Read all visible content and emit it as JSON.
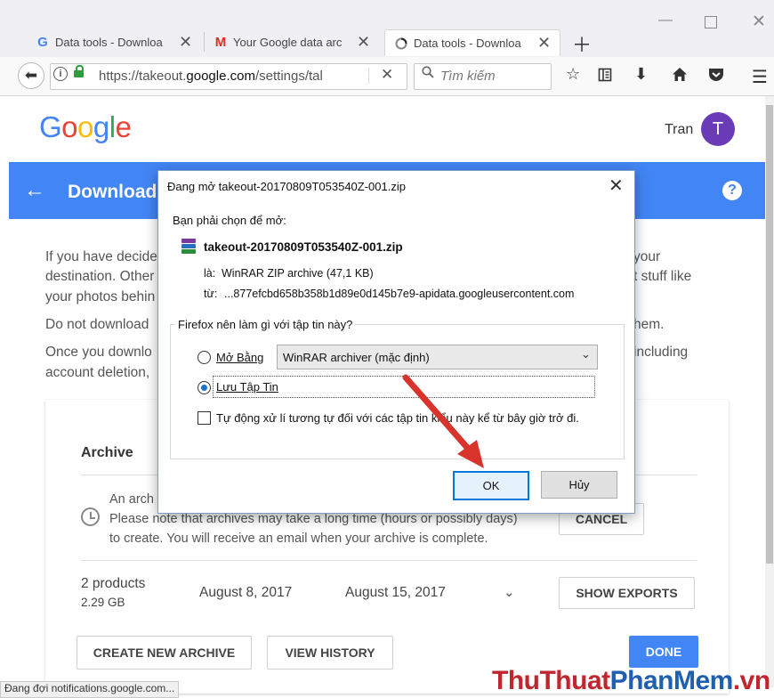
{
  "browser": {
    "tabs": [
      {
        "title": "Data tools - Downloa",
        "favicon": "google-g-icon"
      },
      {
        "title": "Your Google data arc",
        "favicon": "gmail-icon"
      },
      {
        "title": "Data tools - Downloa",
        "favicon": "loading-icon"
      }
    ],
    "url_prefix": "https://takeout.",
    "url_domain": "google.com",
    "url_suffix": "/settings/tal",
    "search_placeholder": "Tìm kiếm",
    "status_text": "Đang đợi notifications.google.com..."
  },
  "page": {
    "logo_letters": [
      "G",
      "o",
      "o",
      "g",
      "l",
      "e"
    ],
    "logo_colors": [
      "#4285F4",
      "#EA4335",
      "#FBBC05",
      "#4285F4",
      "#34A853",
      "#EA4335"
    ],
    "user_name": "Tran",
    "avatar_letter": "T",
    "title": "Download",
    "para1_line1_left": "If you have decide",
    "para1_line1_right": "your",
    "para1_line2_left": "destination. Other",
    "para1_line2_right": "t stuff like",
    "para1_line3_left": "your photos behin",
    "para2_left": "Do not download",
    "para2_right": "hem.",
    "para3_line1_left": "Once you downlo",
    "para3_line1_right": "including",
    "para3_line2_left": "account deletion,",
    "archive_heading": "Archive",
    "archive_line1": "An arch",
    "archive_line2": "Please note that archives may take a long time (hours or possibly days)",
    "archive_line3": "to create. You will receive an email when your archive is complete.",
    "cancel_label": "CANCEL",
    "products_count": "2 products",
    "products_size": "2.29 GB",
    "created_date": "August 8, 2017",
    "expires_date": "August 15, 2017",
    "show_exports_label": "SHOW EXPORTS",
    "create_new_label": "CREATE NEW ARCHIVE",
    "view_history_label": "VIEW HISTORY",
    "done_label": "DONE",
    "accent_color": "#4285f4"
  },
  "dialog": {
    "title": "Đang mở takeout-20170809T053540Z-001.zip",
    "prompt": "Bạn phải chọn để mở:",
    "filename": "takeout-20170809T053540Z-001.zip",
    "type_label": "là:",
    "type_value": "WinRAR ZIP archive (47,1 KB)",
    "from_label": "từ:",
    "from_value": "...877efcbd658b358b1d89e0d145b7e9-apidata.googleusercontent.com",
    "group_label": "Firefox nên làm gì với tập tin này?",
    "open_with_label": "Mở Bằng",
    "open_with_value": "WinRAR archiver (mặc định)",
    "save_label": "Lưu Tập Tin",
    "auto_label": "Tự động xử lí tương tự đối với các tập tin kiểu này kể từ bây giờ trở đi.",
    "ok_label": "OK",
    "cancel_label": "Hủy",
    "selected_option": "save"
  },
  "watermark": {
    "part1": "ThuThuat",
    "part2": "PhanMem",
    "part3": ".vn",
    "color1": "#c0262d",
    "color2": "#1f5fb0"
  }
}
